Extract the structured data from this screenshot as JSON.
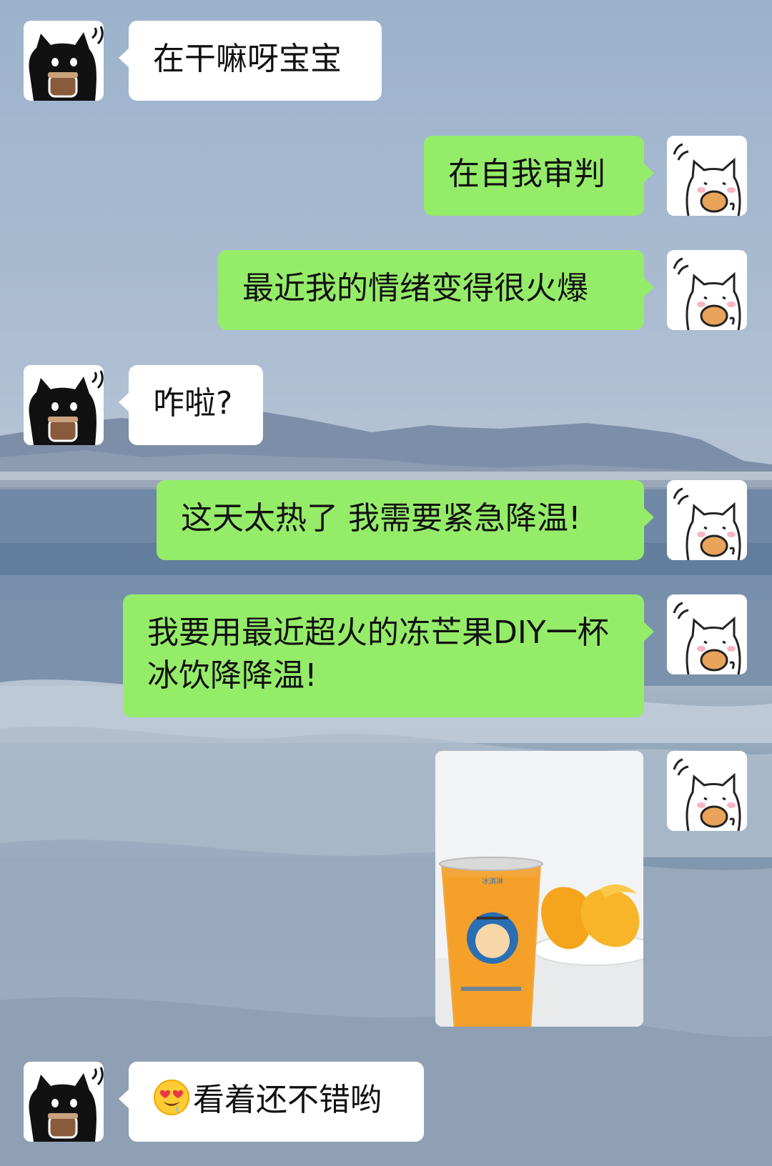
{
  "messages": [
    {
      "side": "left",
      "text": "在干嘛呀宝宝"
    },
    {
      "side": "right",
      "text": "在自我审判"
    },
    {
      "side": "right",
      "text": "最近我的情绪变得很火爆"
    },
    {
      "side": "left",
      "text": "咋啦?"
    },
    {
      "side": "right",
      "text": "这天太热了 我需要紧急降温!"
    },
    {
      "side": "right",
      "text": "我要用最近超火的冻芒果DIY一杯冰饮降降温!"
    },
    {
      "side": "right",
      "image": "mango-drink-photo"
    },
    {
      "side": "left",
      "emoji": "heart-eyes-drool-emoji",
      "text": "看着还不错哟"
    }
  ],
  "avatars": {
    "left": "black-cat-holding-cup-avatar",
    "right": "white-cat-holding-cookie-avatar"
  },
  "colors": {
    "green_bubble": "#95ec69",
    "white_bubble": "#ffffff"
  }
}
